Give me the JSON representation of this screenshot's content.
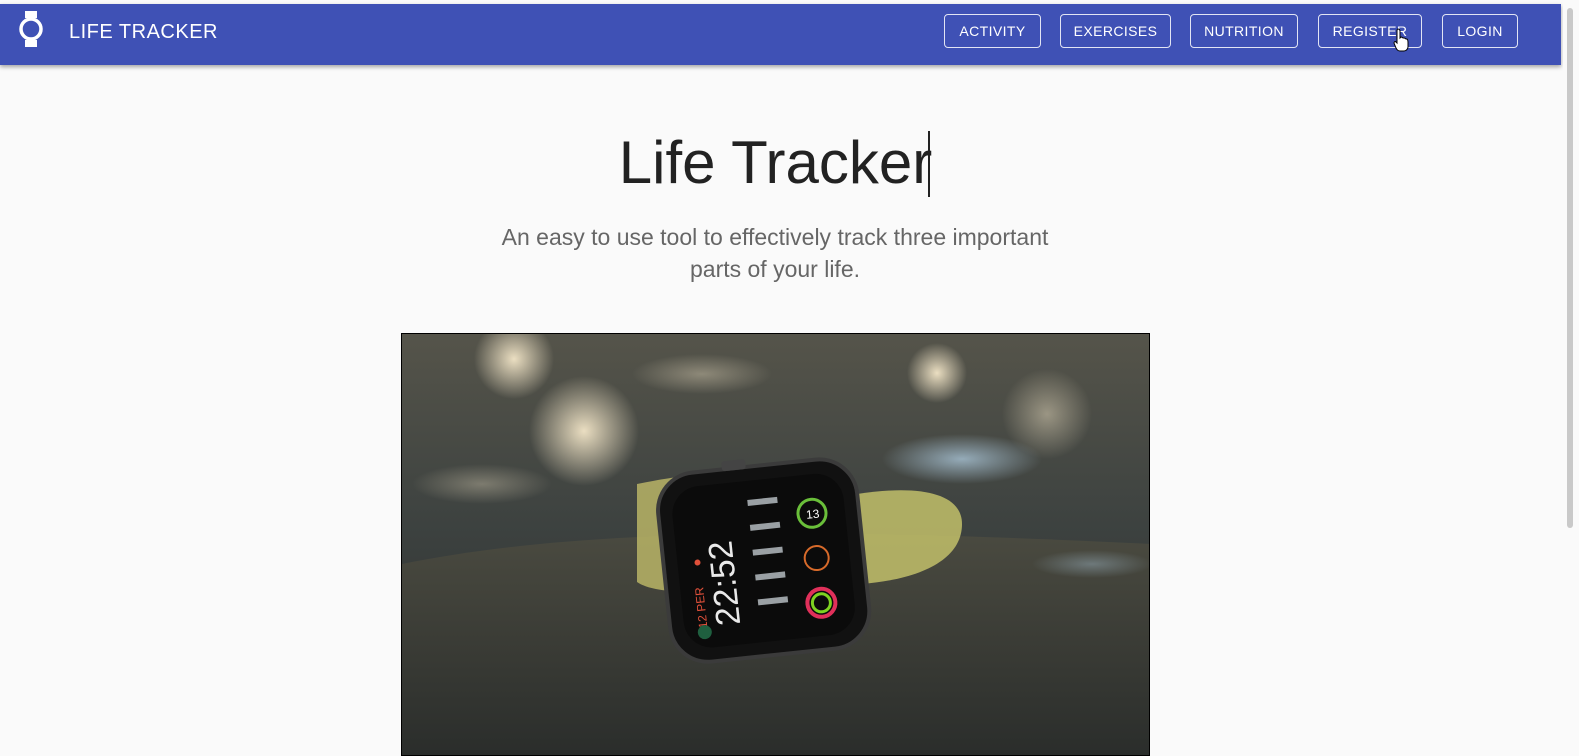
{
  "navbar": {
    "brand_icon": "watch-icon",
    "brand_name": "LIFE TRACKER",
    "links": {
      "activity": "ACTIVITY",
      "exercises": "EXERCISES",
      "nutrition": "NUTRITION",
      "register": "REGISTER",
      "login": "LOGIN"
    },
    "color": "#3f51b5"
  },
  "hero": {
    "title": "Life Tracker",
    "subtitle": "An easy to use tool to effectively track three important parts of your life.",
    "image_icon": "smartwatch-photo",
    "watch_face": {
      "time": "22:52",
      "date_label": "12 PER",
      "ring_value": "13"
    }
  }
}
